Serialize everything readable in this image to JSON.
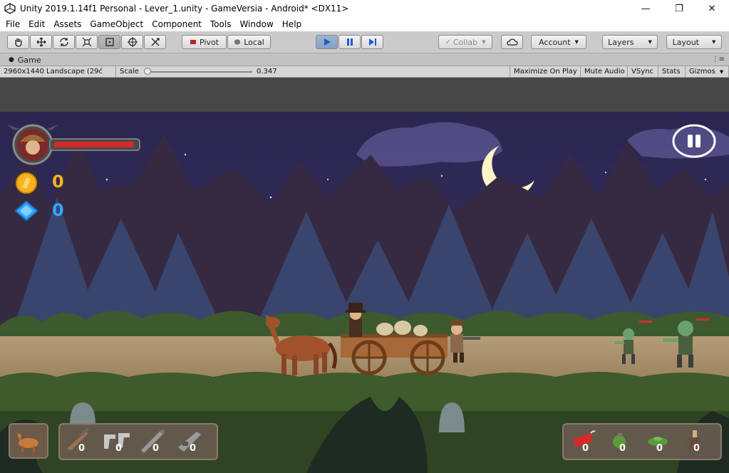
{
  "window": {
    "title": "Unity 2019.1.14f1 Personal - Lever_1.unity - GameVersia - Android* <DX11>",
    "minimize": "—",
    "maximize": "❐",
    "close": "✕"
  },
  "menu": [
    "File",
    "Edit",
    "Assets",
    "GameObject",
    "Component",
    "Tools",
    "Window",
    "Help"
  ],
  "toolbar": {
    "tools": [
      "hand-tool-icon",
      "move-tool-icon",
      "rotate-tool-icon",
      "scale-tool-icon",
      "rect-tool-icon",
      "transform-tool-icon",
      "custom-tool-icon"
    ],
    "pivot_label": "Pivot",
    "local_label": "Local",
    "collab_label": "Collab",
    "account_label": "Account",
    "layers_label": "Layers",
    "layout_label": "Layout"
  },
  "game_tab": {
    "label": "Game"
  },
  "game_bar": {
    "resolution": "2960x1440 Landscape (29ć",
    "scale_label": "Scale",
    "scale_value": "0.347",
    "maximize_on_play": "Maximize On Play",
    "mute_audio": "Mute Audio",
    "vsync": "VSync",
    "stats": "Stats",
    "gizmos": "Gizmos"
  },
  "hud": {
    "coins": "0",
    "gems": "0",
    "health_fraction": 0.97
  },
  "weapons": [
    {
      "icon": "rifle-icon",
      "count": "0"
    },
    {
      "icon": "revolvers-icon",
      "count": "0"
    },
    {
      "icon": "rocket-launcher-icon",
      "count": "0"
    },
    {
      "icon": "machine-gun-icon",
      "count": "0"
    }
  ],
  "items": [
    {
      "icon": "dynamite-icon",
      "count": "0"
    },
    {
      "icon": "grenade-icon",
      "count": "0"
    },
    {
      "icon": "landmine-icon",
      "count": "0"
    },
    {
      "icon": "molotov-icon",
      "count": "0"
    }
  ],
  "colors": {
    "sky": "#2e2a52",
    "coin": "#f7b21e",
    "gem": "#2fa8ff",
    "health": "#d42a2a",
    "play_accent": "#1a5cc8"
  }
}
